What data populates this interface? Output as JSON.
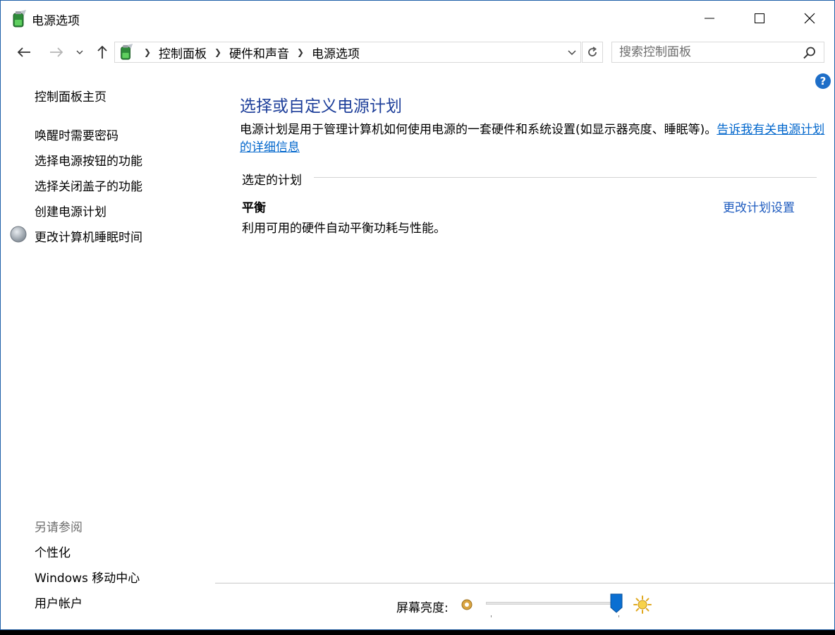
{
  "window": {
    "title": "电源选项"
  },
  "nav": {
    "breadcrumbs": [
      "控制面板",
      "硬件和声音",
      "电源选项"
    ],
    "search_placeholder": "搜索控制面板"
  },
  "sidebar": {
    "home": "控制面板主页",
    "links": [
      "唤醒时需要密码",
      "选择电源按钮的功能",
      "选择关闭盖子的功能",
      "创建电源计划",
      "更改计算机睡眠时间"
    ],
    "see_also_title": "另请参阅",
    "see_also": [
      "个性化",
      "Windows 移动中心",
      "用户帐户"
    ]
  },
  "main": {
    "title": "选择或自定义电源计划",
    "description": "电源计划是用于管理计算机如何使用电源的一套硬件和系统设置(如显示器亮度、睡眠等)。",
    "description_link": "告诉我有关电源计划的详细信息",
    "section_label": "选定的计划",
    "plan": {
      "name": "平衡",
      "description": "利用可用的硬件自动平衡功耗与性能。",
      "settings_link": "更改计划设置"
    }
  },
  "brightness": {
    "label": "屏幕亮度:",
    "level_percent": 100
  },
  "colors": {
    "accent": "#1e3f9a",
    "link": "#0066cc",
    "slider_thumb": "#0a6fd2"
  }
}
